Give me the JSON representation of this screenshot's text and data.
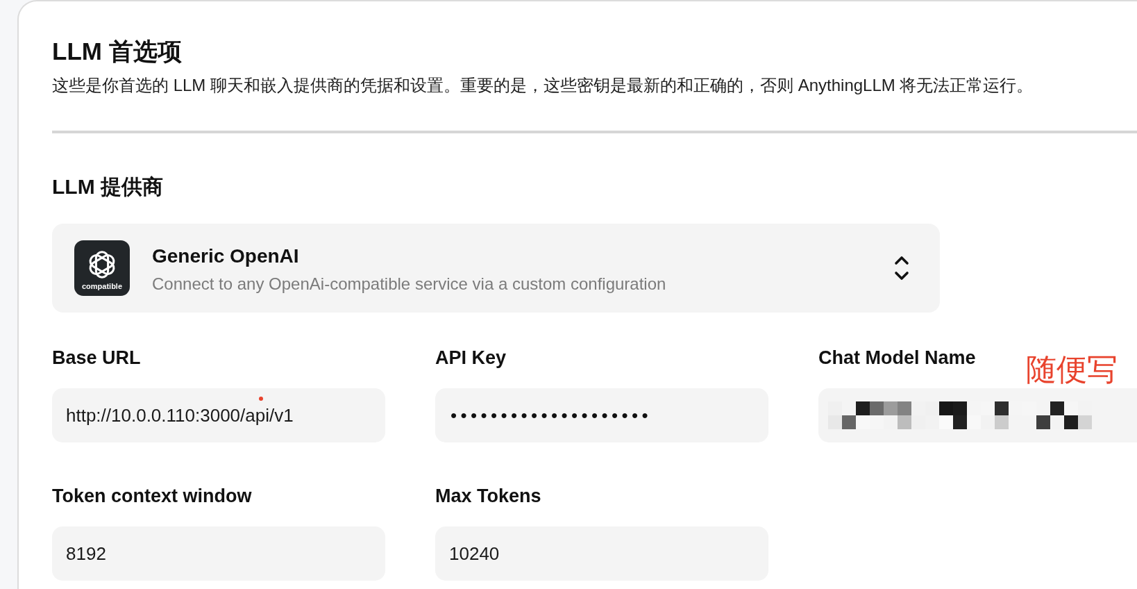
{
  "header": {
    "title": "LLM 首选项",
    "description": "这些是你首选的 LLM 聊天和嵌入提供商的凭据和设置。重要的是，这些密钥是最新的和正确的，否则 AnythingLLM 将无法正常运行。"
  },
  "provider": {
    "heading": "LLM 提供商",
    "selected": {
      "logo_caption": "compatible",
      "name": "Generic OpenAI",
      "description": "Connect to any OpenAi-compatible service via a custom configuration"
    }
  },
  "fields": [
    {
      "label": "Base URL",
      "kind": "text",
      "value": "http://10.0.0.110:3000/api/v1",
      "marked": true
    },
    {
      "label": "API Key",
      "kind": "password",
      "value": "••••••••••••••••••••",
      "marked": false
    },
    {
      "label": "Chat Model Name",
      "kind": "redacted",
      "note": "随便写",
      "marked": false
    },
    {
      "label": "Token context window",
      "kind": "text",
      "value": "8192",
      "marked": false
    },
    {
      "label": "Max Tokens",
      "kind": "text",
      "value": "10240",
      "marked": false
    }
  ]
}
